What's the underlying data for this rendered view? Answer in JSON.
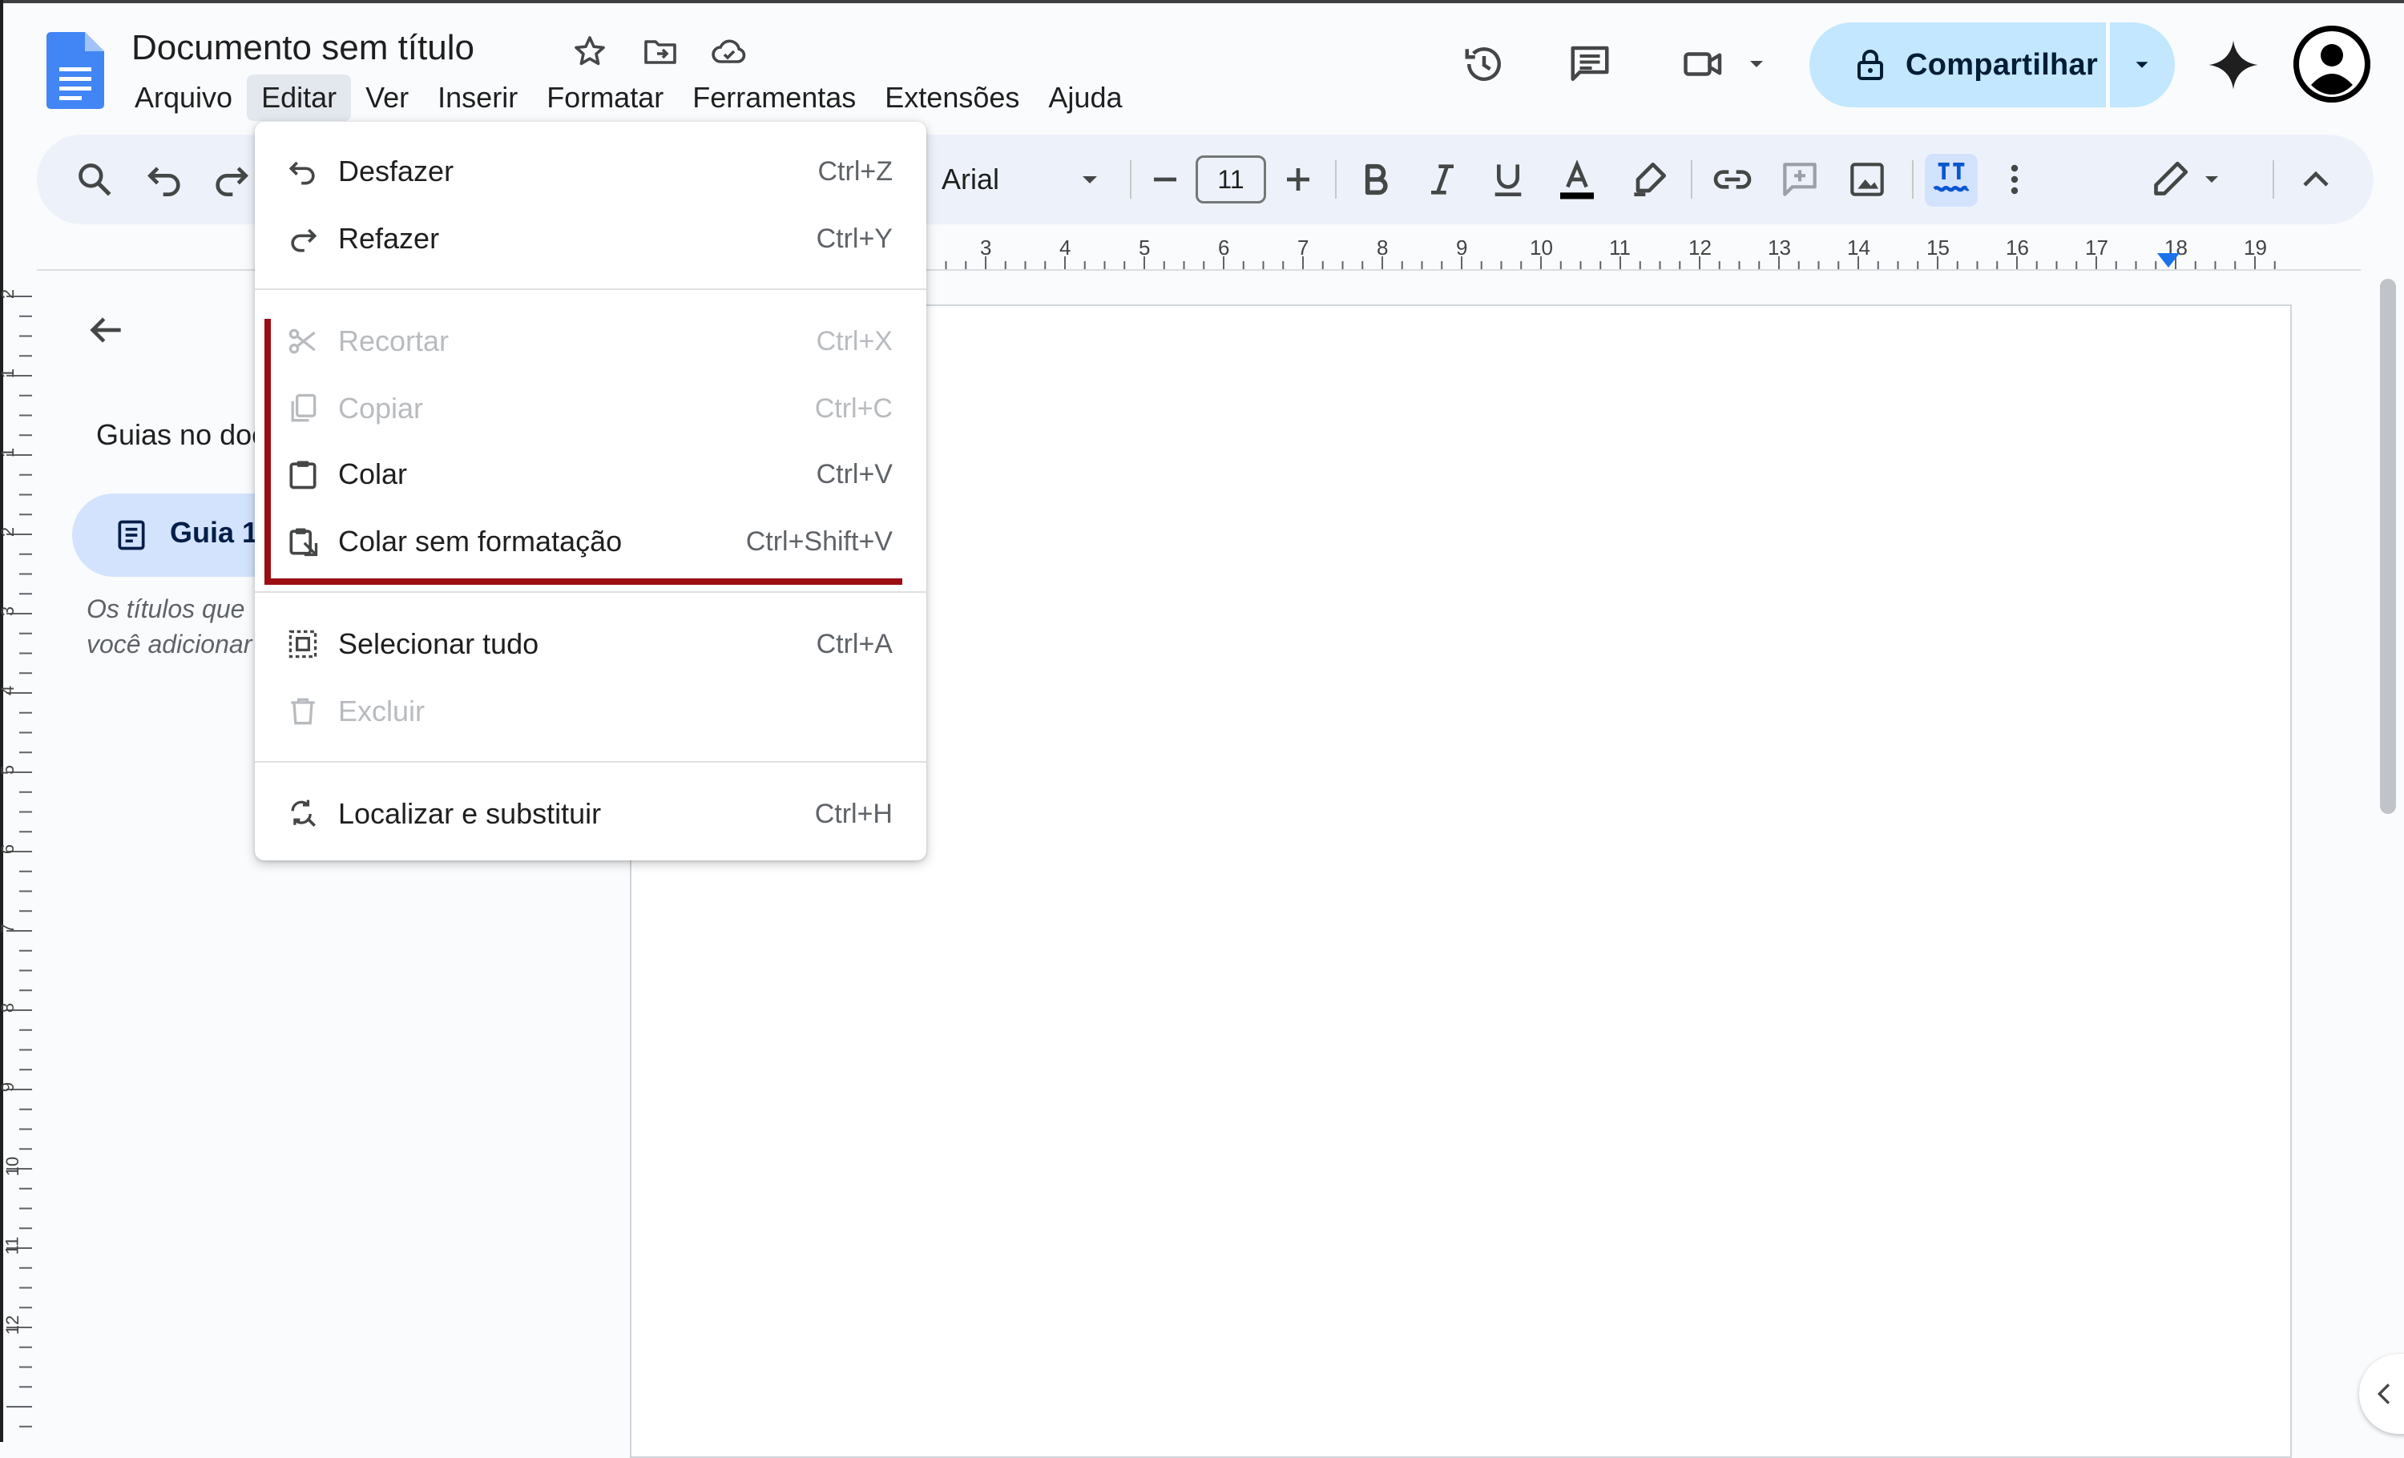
{
  "document": {
    "title": "Documento sem título"
  },
  "menubar": {
    "items": [
      "Arquivo",
      "Editar",
      "Ver",
      "Inserir",
      "Formatar",
      "Ferramentas",
      "Extensões",
      "Ajuda"
    ],
    "active": "Editar"
  },
  "header": {
    "share_label": "Compartilhar",
    "icons": [
      "star-icon",
      "move-to-folder-icon",
      "cloud-saved-icon",
      "history-icon",
      "comments-icon",
      "meet-camera-icon",
      "gemini-spark-icon",
      "account-avatar"
    ]
  },
  "toolbar": {
    "font_name": "Arial",
    "font_size": "11",
    "icons": [
      "search-icon",
      "undo-icon",
      "redo-icon",
      "decrease-font-icon",
      "increase-font-icon",
      "bold-icon",
      "italic-icon",
      "underline-icon",
      "text-color-icon",
      "highlight-icon",
      "link-icon",
      "add-comment-icon",
      "image-icon",
      "spellcheck-icon",
      "more-icon",
      "editing-mode-icon",
      "collapse-icon"
    ],
    "text_color": "#000000"
  },
  "ruler": {
    "numbers": [
      "3",
      "4",
      "5",
      "6",
      "7",
      "8",
      "9",
      "10",
      "11",
      "12",
      "13",
      "14",
      "15",
      "16",
      "17",
      "18",
      "19"
    ],
    "vertical_numbers": [
      "2",
      "1",
      "1",
      "2",
      "3",
      "4",
      "5",
      "6",
      "7",
      "8",
      "9",
      "10",
      "11",
      "12"
    ]
  },
  "outline": {
    "title": "Guias no documento",
    "tab_label": "Guia 1",
    "hint": "Os títulos que você adicionar ao documento aparecerão aqui."
  },
  "edit_menu": {
    "items": [
      {
        "label": "Desfazer",
        "shortcut": "Ctrl+Z",
        "icon": "undo-icon",
        "enabled": true
      },
      {
        "label": "Refazer",
        "shortcut": "Ctrl+Y",
        "icon": "redo-icon",
        "enabled": true
      },
      {
        "label": "Recortar",
        "shortcut": "Ctrl+X",
        "icon": "scissors-icon",
        "enabled": false
      },
      {
        "label": "Copiar",
        "shortcut": "Ctrl+C",
        "icon": "copy-icon",
        "enabled": false
      },
      {
        "label": "Colar",
        "shortcut": "Ctrl+V",
        "icon": "clipboard-icon",
        "enabled": true
      },
      {
        "label": "Colar sem formatação",
        "shortcut": "Ctrl+Shift+V",
        "icon": "paste-plain-icon",
        "enabled": true
      },
      {
        "label": "Selecionar tudo",
        "shortcut": "Ctrl+A",
        "icon": "select-all-icon",
        "enabled": true
      },
      {
        "label": "Excluir",
        "shortcut": "",
        "icon": "trash-icon",
        "enabled": false
      },
      {
        "label": "Localizar e substituir",
        "shortcut": "Ctrl+H",
        "icon": "find-replace-icon",
        "enabled": true
      }
    ]
  },
  "colors": {
    "share_button": "#c2e7ff",
    "highlight_annotation": "#9b0d12",
    "toolbar_bg": "#edf2fa",
    "docs_blue": "#4285f4"
  }
}
